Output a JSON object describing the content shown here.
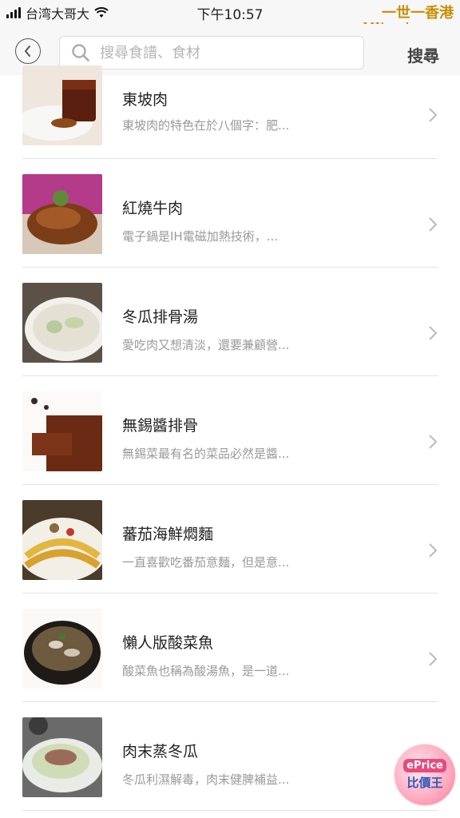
{
  "status_bar": {
    "carrier": "台湾大哥大",
    "time": "下午10:57",
    "watermark_title": "一世一香港",
    "watermark_sub": "141hongkong.com"
  },
  "header": {
    "search_placeholder": "搜尋食譜、食材",
    "search_action": "搜尋"
  },
  "recipes": [
    {
      "title": "東坡肉",
      "desc": "東坡肉的特色在於八個字：肥..."
    },
    {
      "title": "紅燒牛肉",
      "desc": "電子鍋是IH電磁加熱技術，..."
    },
    {
      "title": "冬瓜排骨湯",
      "desc": "愛吃肉又想清淡，還要兼顧營..."
    },
    {
      "title": "無錫醬排骨",
      "desc": "無錫菜最有名的菜品必然是醬..."
    },
    {
      "title": "蕃茄海鮮燜麵",
      "desc": "一直喜歡吃番茄意麵，但是意..."
    },
    {
      "title": "懶人版酸菜魚",
      "desc": "酸菜魚也稱為酸湯魚，是一道..."
    },
    {
      "title": "肉末蒸冬瓜",
      "desc": "冬瓜利濕解毒，肉末健脾補益..."
    }
  ],
  "badge": {
    "top": "ePrice",
    "bottom": "比價王"
  }
}
